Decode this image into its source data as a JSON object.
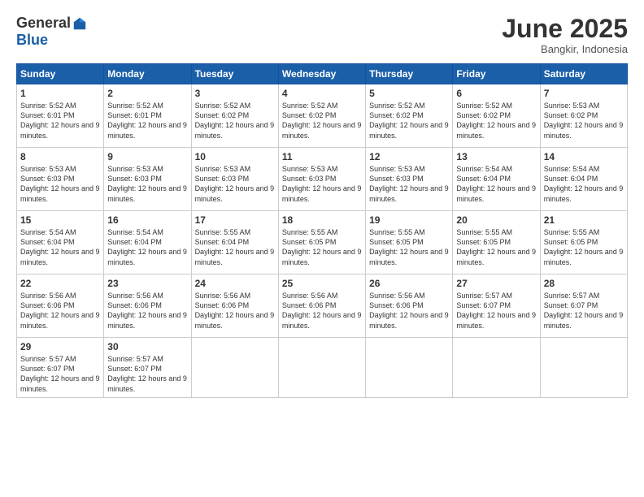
{
  "logo": {
    "general": "General",
    "blue": "Blue"
  },
  "header": {
    "month": "June 2025",
    "location": "Bangkir, Indonesia"
  },
  "days_of_week": [
    "Sunday",
    "Monday",
    "Tuesday",
    "Wednesday",
    "Thursday",
    "Friday",
    "Saturday"
  ],
  "weeks": [
    [
      {
        "day": "1",
        "sunrise": "5:52 AM",
        "sunset": "6:01 PM",
        "daylight": "12 hours and 9 minutes."
      },
      {
        "day": "2",
        "sunrise": "5:52 AM",
        "sunset": "6:01 PM",
        "daylight": "12 hours and 9 minutes."
      },
      {
        "day": "3",
        "sunrise": "5:52 AM",
        "sunset": "6:02 PM",
        "daylight": "12 hours and 9 minutes."
      },
      {
        "day": "4",
        "sunrise": "5:52 AM",
        "sunset": "6:02 PM",
        "daylight": "12 hours and 9 minutes."
      },
      {
        "day": "5",
        "sunrise": "5:52 AM",
        "sunset": "6:02 PM",
        "daylight": "12 hours and 9 minutes."
      },
      {
        "day": "6",
        "sunrise": "5:52 AM",
        "sunset": "6:02 PM",
        "daylight": "12 hours and 9 minutes."
      },
      {
        "day": "7",
        "sunrise": "5:53 AM",
        "sunset": "6:02 PM",
        "daylight": "12 hours and 9 minutes."
      }
    ],
    [
      {
        "day": "8",
        "sunrise": "5:53 AM",
        "sunset": "6:03 PM",
        "daylight": "12 hours and 9 minutes."
      },
      {
        "day": "9",
        "sunrise": "5:53 AM",
        "sunset": "6:03 PM",
        "daylight": "12 hours and 9 minutes."
      },
      {
        "day": "10",
        "sunrise": "5:53 AM",
        "sunset": "6:03 PM",
        "daylight": "12 hours and 9 minutes."
      },
      {
        "day": "11",
        "sunrise": "5:53 AM",
        "sunset": "6:03 PM",
        "daylight": "12 hours and 9 minutes."
      },
      {
        "day": "12",
        "sunrise": "5:53 AM",
        "sunset": "6:03 PM",
        "daylight": "12 hours and 9 minutes."
      },
      {
        "day": "13",
        "sunrise": "5:54 AM",
        "sunset": "6:04 PM",
        "daylight": "12 hours and 9 minutes."
      },
      {
        "day": "14",
        "sunrise": "5:54 AM",
        "sunset": "6:04 PM",
        "daylight": "12 hours and 9 minutes."
      }
    ],
    [
      {
        "day": "15",
        "sunrise": "5:54 AM",
        "sunset": "6:04 PM",
        "daylight": "12 hours and 9 minutes."
      },
      {
        "day": "16",
        "sunrise": "5:54 AM",
        "sunset": "6:04 PM",
        "daylight": "12 hours and 9 minutes."
      },
      {
        "day": "17",
        "sunrise": "5:55 AM",
        "sunset": "6:04 PM",
        "daylight": "12 hours and 9 minutes."
      },
      {
        "day": "18",
        "sunrise": "5:55 AM",
        "sunset": "6:05 PM",
        "daylight": "12 hours and 9 minutes."
      },
      {
        "day": "19",
        "sunrise": "5:55 AM",
        "sunset": "6:05 PM",
        "daylight": "12 hours and 9 minutes."
      },
      {
        "day": "20",
        "sunrise": "5:55 AM",
        "sunset": "6:05 PM",
        "daylight": "12 hours and 9 minutes."
      },
      {
        "day": "21",
        "sunrise": "5:55 AM",
        "sunset": "6:05 PM",
        "daylight": "12 hours and 9 minutes."
      }
    ],
    [
      {
        "day": "22",
        "sunrise": "5:56 AM",
        "sunset": "6:06 PM",
        "daylight": "12 hours and 9 minutes."
      },
      {
        "day": "23",
        "sunrise": "5:56 AM",
        "sunset": "6:06 PM",
        "daylight": "12 hours and 9 minutes."
      },
      {
        "day": "24",
        "sunrise": "5:56 AM",
        "sunset": "6:06 PM",
        "daylight": "12 hours and 9 minutes."
      },
      {
        "day": "25",
        "sunrise": "5:56 AM",
        "sunset": "6:06 PM",
        "daylight": "12 hours and 9 minutes."
      },
      {
        "day": "26",
        "sunrise": "5:56 AM",
        "sunset": "6:06 PM",
        "daylight": "12 hours and 9 minutes."
      },
      {
        "day": "27",
        "sunrise": "5:57 AM",
        "sunset": "6:07 PM",
        "daylight": "12 hours and 9 minutes."
      },
      {
        "day": "28",
        "sunrise": "5:57 AM",
        "sunset": "6:07 PM",
        "daylight": "12 hours and 9 minutes."
      }
    ],
    [
      {
        "day": "29",
        "sunrise": "5:57 AM",
        "sunset": "6:07 PM",
        "daylight": "12 hours and 9 minutes."
      },
      {
        "day": "30",
        "sunrise": "5:57 AM",
        "sunset": "6:07 PM",
        "daylight": "12 hours and 9 minutes."
      },
      null,
      null,
      null,
      null,
      null
    ]
  ]
}
